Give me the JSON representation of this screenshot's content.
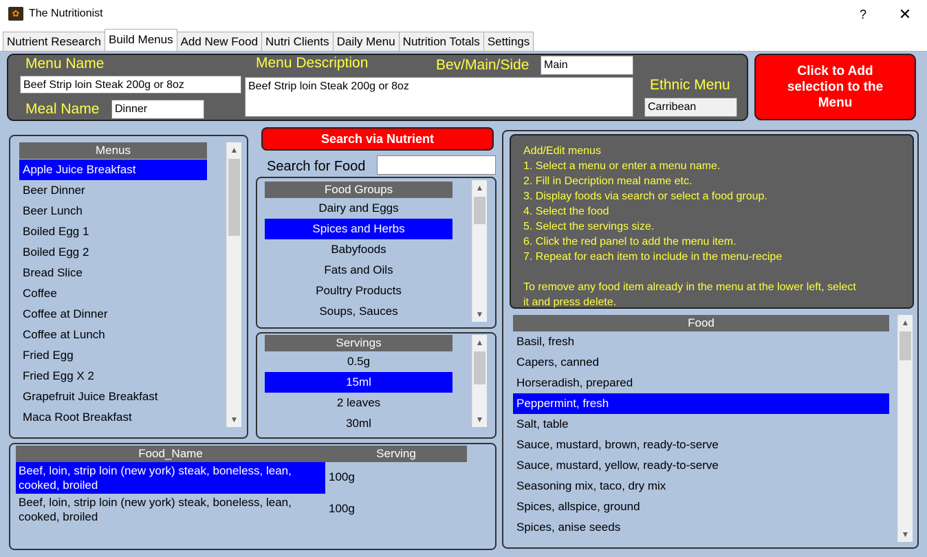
{
  "window": {
    "title": "The Nutritionist",
    "help_label": "?",
    "close_label": "✕"
  },
  "tabs": [
    {
      "label": "Nutrient Research"
    },
    {
      "label": "Build Menus",
      "active": true
    },
    {
      "label": "Add New Food"
    },
    {
      "label": "Nutri Clients"
    },
    {
      "label": "Daily Menu"
    },
    {
      "label": "Nutrition Totals"
    },
    {
      "label": "Settings"
    }
  ],
  "menu_form": {
    "menu_name_label": "Menu Name",
    "menu_name_value": "Beef Strip loin Steak 200g or 8oz",
    "meal_name_label": "Meal Name",
    "meal_name_value": "Dinner",
    "description_label": "Menu Description",
    "description_value": "Beef Strip loin Steak 200g or 8oz",
    "bev_label": "Bev/Main/Side",
    "bev_value": "Main",
    "ethnic_label": "Ethnic Menu",
    "ethnic_value": "Carribean"
  },
  "add_button": {
    "label": "Click to Add selection to the Menu",
    "color": "#ff0000"
  },
  "menus_list": {
    "header": "Menus",
    "items": [
      "Apple Juice Breakfast",
      "Beer Dinner",
      "Beer Lunch",
      "Boiled Egg 1",
      "Boiled Egg 2",
      "Bread Slice",
      "Coffee",
      "Coffee at  Dinner",
      "Coffee at  Lunch",
      "Fried Egg",
      "Fried Egg X 2",
      "Grapefruit Juice Breakfast",
      "Maca Root Breakfast"
    ],
    "selected_index": 0
  },
  "search": {
    "nutrient_button": "Search via Nutrient",
    "food_label": "Search for Food",
    "food_value": ""
  },
  "food_groups": {
    "header": "Food Groups",
    "items": [
      "Dairy and Eggs",
      "Spices and Herbs",
      "Babyfoods",
      "Fats and Oils",
      "Poultry Products",
      "Soups, Sauces"
    ],
    "selected_index": 1
  },
  "servings": {
    "header": "Servings",
    "items": [
      "0.5g",
      "15ml",
      "2 leaves",
      "30ml"
    ],
    "selected_index": 1
  },
  "menu_items_table": {
    "col_food": "Food_Name",
    "col_serving": "Serving",
    "rows": [
      {
        "food_line1": "Beef, loin, strip loin (new york) steak, boneless, lean,",
        "food_line2": "cooked, broiled",
        "serving": "100g",
        "selected": true
      },
      {
        "food_line1": "Beef, loin, strip loin (new york) steak, boneless, lean,",
        "food_line2": "cooked, broiled",
        "serving": "100g",
        "selected": false
      }
    ]
  },
  "help": {
    "lines": [
      "Add/Edit menus",
      "1. Select a menu or enter a menu name.",
      "2. Fill in Decription meal name etc.",
      "3. Display foods via search or select a food group.",
      "4. Select the food",
      "5. Select the servings size.",
      "6. Click the red panel to add the menu item.",
      "7. Repeat for each item to include in the menu-recipe",
      "",
      "To remove any food item already in the menu at the lower left, select",
      "it and press delete."
    ]
  },
  "food_list": {
    "header": "Food",
    "items": [
      "Basil, fresh",
      "Capers, canned",
      "Horseradish, prepared",
      "Peppermint, fresh",
      "Salt, table",
      "Sauce, mustard, brown, ready-to-serve",
      "Sauce, mustard, yellow, ready-to-serve",
      "Seasoning mix, taco, dry mix",
      "Spices, allspice, ground",
      "Spices, anise seeds"
    ],
    "selected_index": 3
  },
  "colors": {
    "background": "#b0c4de",
    "dark_panel": "#5f5f5f",
    "label_yellow": "#ffff44",
    "selection_blue": "#0000ff",
    "header_grey": "#666666"
  }
}
